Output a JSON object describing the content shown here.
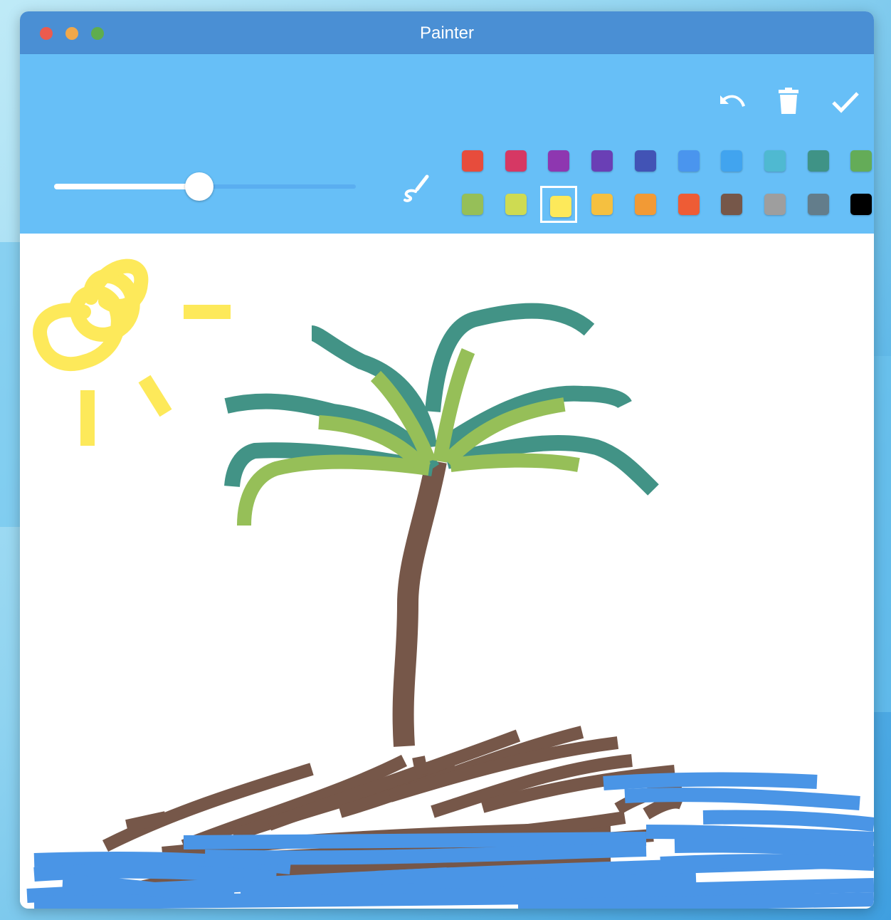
{
  "window": {
    "title": "Painter"
  },
  "toolbar": {
    "actions": [
      {
        "icon": "undo-icon"
      },
      {
        "icon": "trash-icon"
      },
      {
        "icon": "check-icon"
      }
    ],
    "stroke_width_fraction": 0.48,
    "brush_icon": "brush-icon",
    "selected_color_index": 12,
    "palette": [
      "#e74c3c",
      "#d63864",
      "#8e37b0",
      "#6a3fb5",
      "#4253b5",
      "#4a95ee",
      "#41a4ef",
      "#4fb9d1",
      "#3f9386",
      "#64ac58",
      "#96bf58",
      "#cedb52",
      "#fde95a",
      "#f5c040",
      "#f29a35",
      "#ee5c35",
      "#765749",
      "#9e9e9e",
      "#637d8b",
      "#000000"
    ]
  },
  "canvas": {
    "colors": {
      "sun": "#fde95a",
      "frond_dark": "#429386",
      "frond_light": "#96bf58",
      "trunk": "#765749",
      "water": "#4a95e6"
    }
  }
}
